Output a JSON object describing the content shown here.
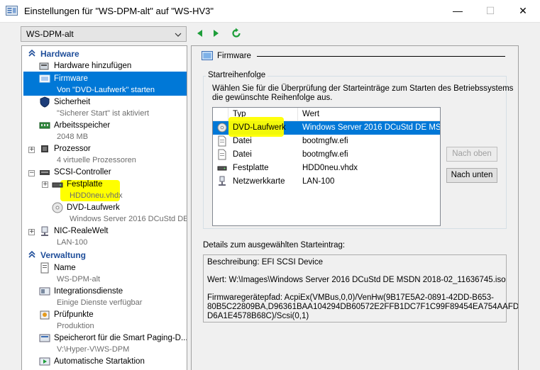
{
  "window": {
    "title": "Einstellungen für \"WS-DPM-alt\" auf \"WS-HV3\"",
    "minimize_glyph": "—",
    "maximize_glyph": "☐",
    "close_glyph": "✕"
  },
  "vm_selector": {
    "value": "WS-DPM-alt"
  },
  "tree": {
    "hardware_header": "Hardware",
    "management_header": "Verwaltung",
    "items": {
      "add_hardware": {
        "label": "Hardware hinzufügen"
      },
      "firmware": {
        "label": "Firmware",
        "sub": "Von \"DVD-Laufwerk\" starten"
      },
      "security": {
        "label": "Sicherheit",
        "sub": "\"Sicherer Start\" ist aktiviert"
      },
      "memory": {
        "label": "Arbeitsspeicher",
        "sub": "2048 MB"
      },
      "processor": {
        "label": "Prozessor",
        "sub": "4 virtuelle Prozessoren"
      },
      "scsi": {
        "label": "SCSI-Controller"
      },
      "harddisk": {
        "label": "Festplatte",
        "sub": "HDD0neu.vhdx"
      },
      "dvd": {
        "label": "DVD-Laufwerk",
        "sub": "Windows Server 2016 DCuStd DE ..."
      },
      "nic": {
        "label": "NIC-RealeWelt",
        "sub": "LAN-100"
      },
      "name": {
        "label": "Name",
        "sub": "WS-DPM-alt"
      },
      "integration": {
        "label": "Integrationsdienste",
        "sub": "Einige Dienste verfügbar"
      },
      "checkpoints": {
        "label": "Prüfpunkte",
        "sub": "Produktion"
      },
      "smartpaging": {
        "label": "Speicherort für die Smart Paging-D...",
        "sub": "V:\\Hyper-V\\WS-DPM"
      },
      "autostart": {
        "label": "Automatische Startaktion"
      }
    }
  },
  "firmware_panel": {
    "header": "Firmware",
    "boot_order_title": "Startreihenfolge",
    "boot_order_desc_line1": "Wählen Sie für die Überprüfung der Starteinträge zum Starten des Betriebssystems",
    "boot_order_desc_line2": "die gewünschte Reihenfolge aus.",
    "columns": {
      "type": "Typ",
      "value": "Wert"
    },
    "rows": [
      {
        "type": "DVD-Laufwerk",
        "value": "Windows Server 2016 DCuStd DE MS...",
        "icon": "dvd-icon"
      },
      {
        "type": "Datei",
        "value": "bootmgfw.efi",
        "icon": "file-icon"
      },
      {
        "type": "Datei",
        "value": "bootmgfw.efi",
        "icon": "file-icon"
      },
      {
        "type": "Festplatte",
        "value": "HDD0neu.vhdx",
        "icon": "harddisk-icon"
      },
      {
        "type": "Netzwerkkarte",
        "value": "LAN-100",
        "icon": "network-icon"
      }
    ],
    "move_up_label": "Nach oben",
    "move_down_label": "Nach unten",
    "details_label": "Details zum ausgewählten Starteintrag:",
    "details": {
      "description": "Beschreibung: EFI SCSI Device",
      "value": "Wert: W:\\Images\\Windows Server 2016 DCuStd DE MSDN 2018-02_11636745.iso",
      "path_line1": "Firmwaregerätepfad: AcpiEx(VMBus,0,0)/VenHw(9B17E5A2-0891-42DD-B653-",
      "path_line2": "80B5C22809BA,D96361BAA104294DB60572E2FFB1DC7F1C99F89454EA754AAFD",
      "path_line3": "D6A1E4578B68C)/Scsi(0,1)"
    }
  },
  "colors": {
    "selection": "#0078d7",
    "section_header": "#1f4e9a",
    "annotation_highlight": "#ffff00",
    "nav_arrow": "#1e9e3a"
  }
}
